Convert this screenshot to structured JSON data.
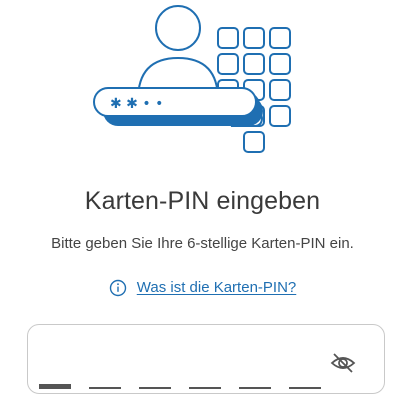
{
  "header": {
    "title": "Karten-PIN eingeben",
    "subtitle": "Bitte geben Sie Ihre 6-stellige Karten-PIN ein."
  },
  "help": {
    "icon": "info-icon",
    "link_label": "Was ist die Karten-PIN?"
  },
  "illustration": {
    "masked_pin": "✱ ✱ • •",
    "icon": "person-keypad-pin-illustration"
  },
  "pin_input": {
    "digits_total": 6,
    "digits_entered": 0,
    "visibility_icon": "eye-slash-icon"
  },
  "colors": {
    "accent": "#1f6fb2",
    "text": "#3a3a3a",
    "border": "#c9c9c9"
  }
}
